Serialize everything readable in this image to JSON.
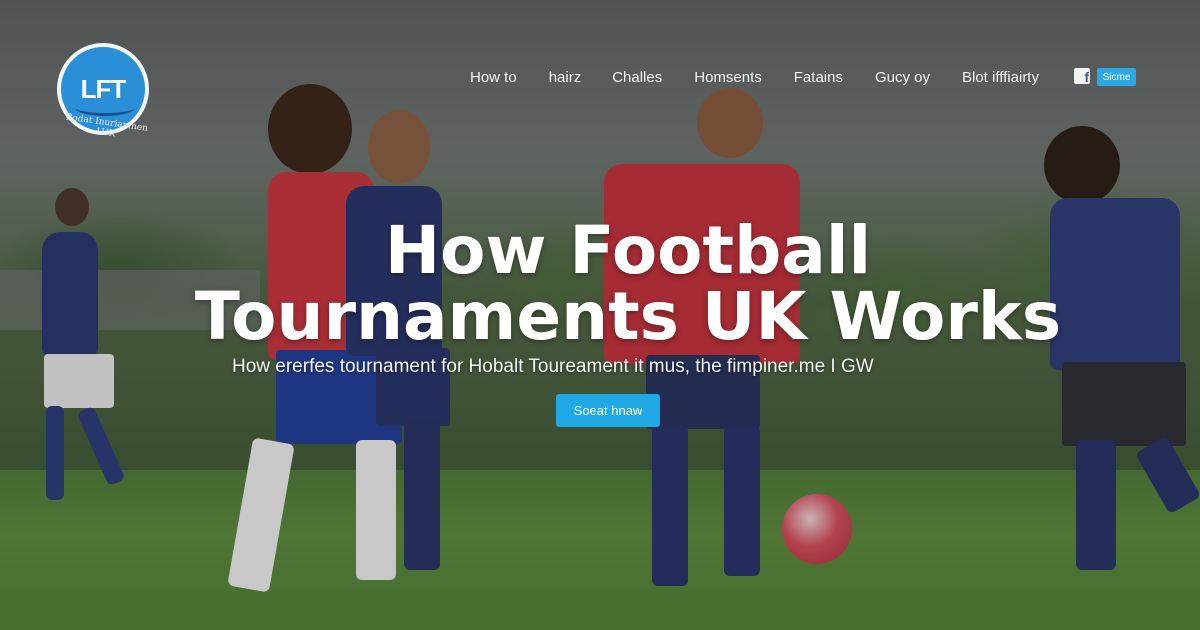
{
  "logo": {
    "text": "LFT",
    "caption": "Rodat Inuriamnen 1UK",
    "icon": "soccer-logo-icon"
  },
  "nav": {
    "items": [
      "How to",
      "hairz",
      "Challes",
      "Homsents",
      "Fatains",
      "Gucy oy",
      "Blot ifffiairty"
    ],
    "facebook_icon": "facebook-icon",
    "share_label": "Sicme"
  },
  "hero": {
    "title_line1": "How Football",
    "title_line2": "Tournaments UK Works",
    "subtitle": "How ererfes tournament for Hobalt Toureament it mus, the fimpiner.me I GW",
    "cta_label": "Soeat hnaw"
  },
  "colors": {
    "accent": "#1ea8e4",
    "logo_blue": "#2a8fd6",
    "text": "#ffffff"
  }
}
